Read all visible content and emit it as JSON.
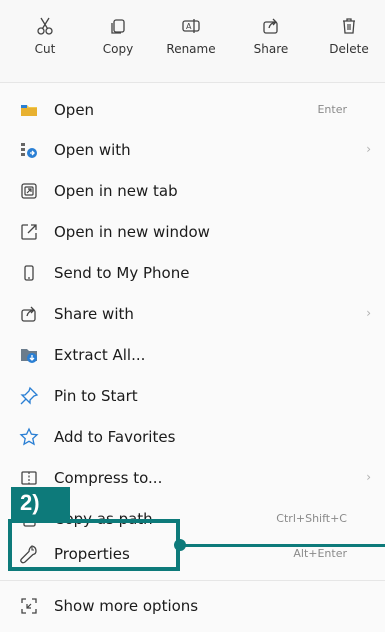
{
  "toolbar": {
    "cut": "Cut",
    "copy": "Copy",
    "rename": "Rename",
    "share": "Share",
    "delete": "Delete"
  },
  "menu": {
    "items": [
      {
        "label": "Open",
        "shortcut": "Enter",
        "icon": "folder-icon"
      },
      {
        "label": "Open with",
        "shortcut": "",
        "icon": "open-with-icon",
        "has_submenu": true
      },
      {
        "label": "Open in new tab",
        "shortcut": "",
        "icon": "new-tab-icon"
      },
      {
        "label": "Open in new window",
        "shortcut": "",
        "icon": "new-window-icon"
      },
      {
        "label": "Send to My Phone",
        "shortcut": "",
        "icon": "phone-icon"
      },
      {
        "label": "Share with",
        "shortcut": "",
        "icon": "share-icon",
        "has_submenu": true
      },
      {
        "label": "Extract All...",
        "shortcut": "",
        "icon": "extract-icon"
      },
      {
        "label": "Pin to Start",
        "shortcut": "",
        "icon": "pin-icon"
      },
      {
        "label": "Add to Favorites",
        "shortcut": "",
        "icon": "star-icon"
      },
      {
        "label": "Compress to...",
        "shortcut": "",
        "icon": "compress-icon"
      },
      {
        "label": "Copy as path",
        "shortcut": "Ctrl+Shift+C",
        "icon": "copy-path-icon"
      },
      {
        "label": "Properties",
        "shortcut": "Alt+Enter",
        "icon": "wrench-icon"
      },
      {
        "label": "Show more options",
        "shortcut": "",
        "icon": "more-options-icon"
      }
    ]
  },
  "annotation": {
    "tag": "2)",
    "color": "#0d7a7a"
  }
}
